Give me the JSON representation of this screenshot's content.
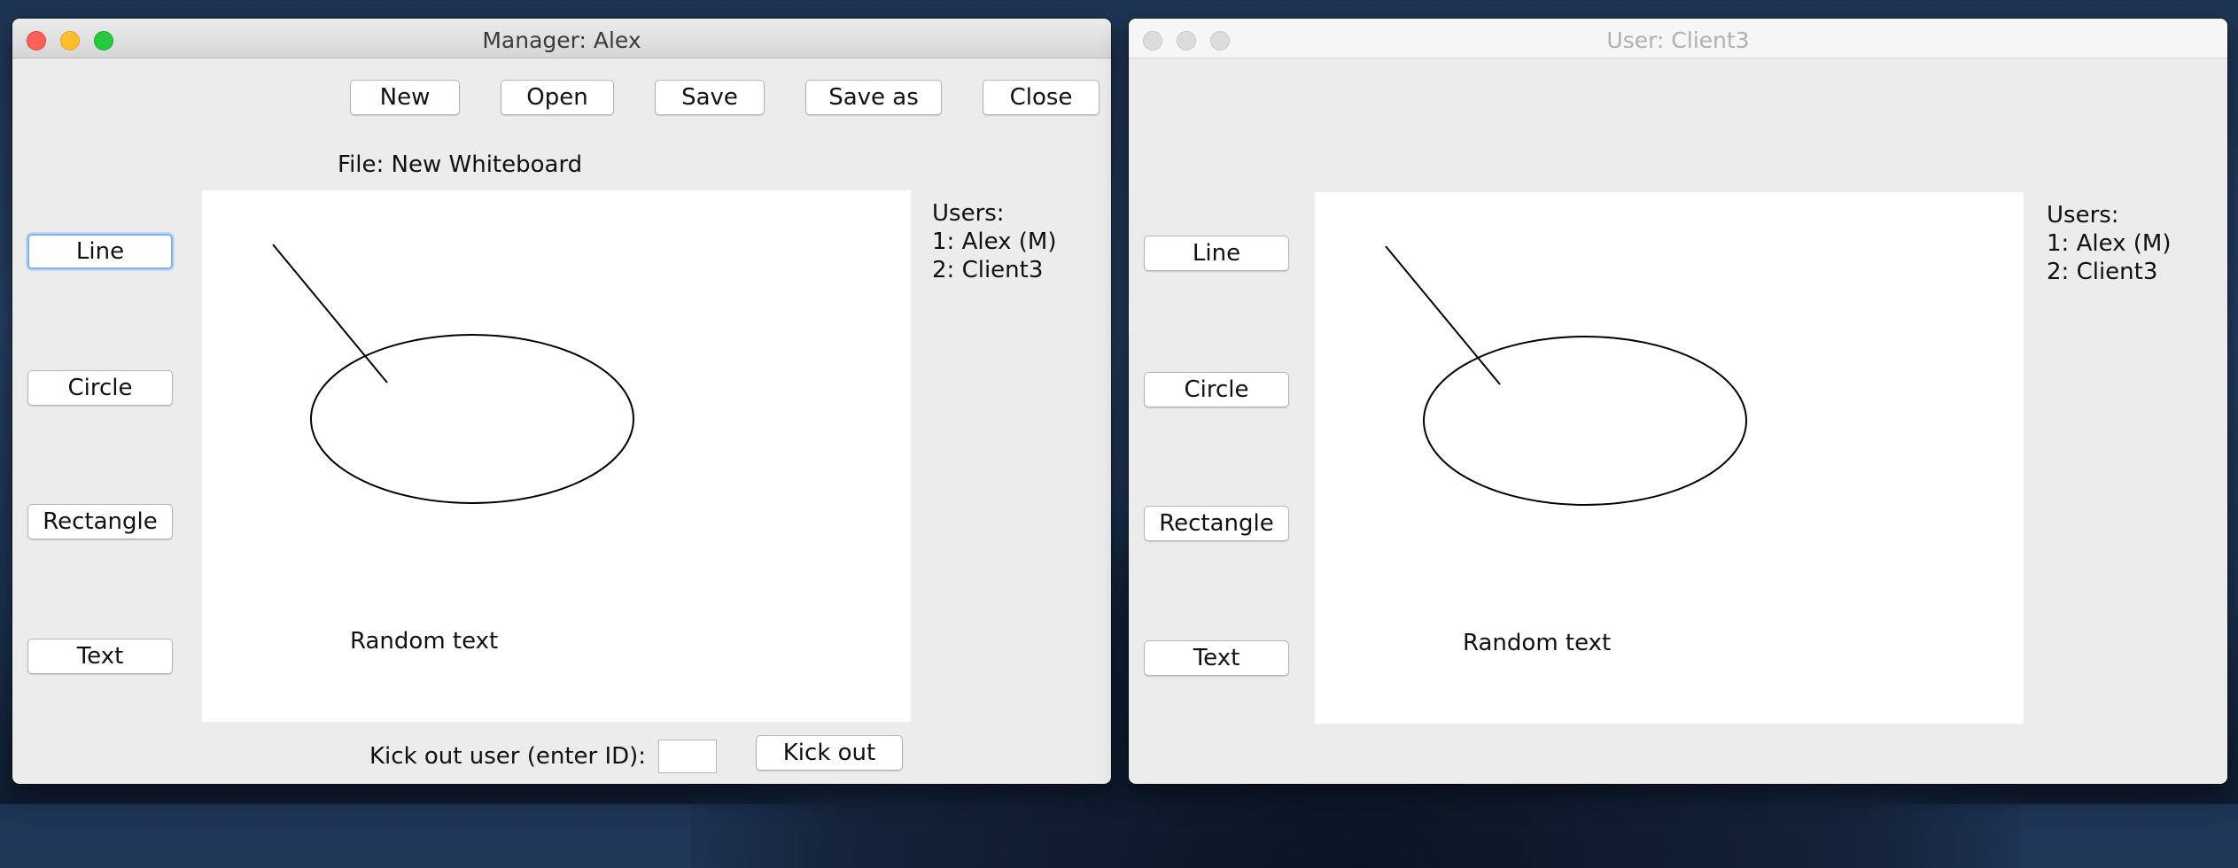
{
  "manager_window": {
    "title": "Manager: Alex",
    "toolbar": {
      "new_label": "New",
      "open_label": "Open",
      "save_label": "Save",
      "save_as_label": "Save as",
      "close_label": "Close"
    },
    "file_label": "File: New Whiteboard",
    "tools": {
      "line": "Line",
      "circle": "Circle",
      "rectangle": "Rectangle",
      "text": "Text"
    },
    "canvas_text": "Random text",
    "users": {
      "heading": "Users:",
      "list": [
        "1: Alex (M)",
        "2: Client3"
      ]
    },
    "kick": {
      "label": "Kick out user (enter ID):",
      "input_value": "",
      "button_label": "Kick out"
    }
  },
  "user_window": {
    "title": "User: Client3",
    "tools": {
      "line": "Line",
      "circle": "Circle",
      "rectangle": "Rectangle",
      "text": "Text"
    },
    "canvas_text": "Random text",
    "users": {
      "heading": "Users:",
      "list": [
        "1: Alex (M)",
        "2: Client3"
      ]
    }
  },
  "colors": {
    "close": "#fe5f57",
    "minimize": "#febc2e",
    "maximize": "#28c840",
    "focus_ring": "#7eb2ee",
    "window_bg": "#ececec",
    "canvas_bg": "#ffffff"
  }
}
